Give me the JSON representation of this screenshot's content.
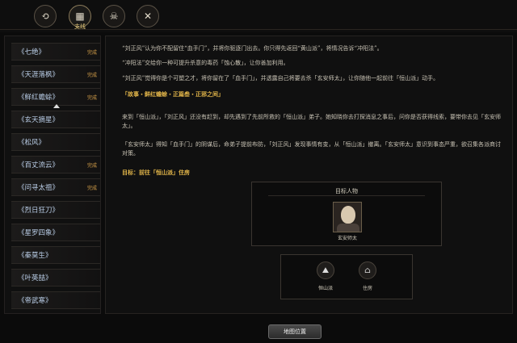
{
  "tabs": {
    "items": [
      {
        "icon": "quest-icon",
        "glyph": "⟲"
      },
      {
        "icon": "scroll-icon",
        "glyph": "▦",
        "label": "支线"
      },
      {
        "icon": "skull-icon",
        "glyph": "☠"
      },
      {
        "icon": "crossed-swords-icon",
        "glyph": "✕"
      }
    ]
  },
  "sidebar": {
    "items": [
      {
        "label": "《七绝》",
        "badge": "完成"
      },
      {
        "label": "《天涯落枫》",
        "badge": "完成"
      },
      {
        "label": "《鲜红蟾蜍》",
        "badge": "完成"
      },
      {
        "label": "《玄天摘星》",
        "badge": ""
      },
      {
        "label": "《松风》",
        "badge": ""
      },
      {
        "label": "《百丈流云》",
        "badge": "完成"
      },
      {
        "label": "《问寻太祖》",
        "badge": "完成"
      },
      {
        "label": "《烈日狂刀》",
        "badge": ""
      },
      {
        "label": "《星罗四象》",
        "badge": ""
      },
      {
        "label": "《秦莫生》",
        "badge": ""
      },
      {
        "label": "《叶英喆》",
        "badge": ""
      },
      {
        "label": "《帝武寒》",
        "badge": ""
      }
    ]
  },
  "quest": {
    "p0": "“刘正风”认为你不配留住“血手门”，并将你驱逐门出去。你只得先返回“黄山派”，将情况告诉“冲阳法”。",
    "p1": "“冲阳法”交给你一种可提升杀意的毒药「蚀心散」，让你善加利用。",
    "p2": "“刘正风”觉得你是个可塑之才，将你留在了「血手门」，并透露自己将要去杀「玄安师太」，让你随他一起前往「恒山派」动手。",
    "chapter": "「故事・鲜红蟾蜍・正篇叁・正邪之间」",
    "p3": "来到「恒山派」，「刘正风」还没有赶到，却先遇到了先前所救的「恒山派」弟子。她知晓你去打探消息之事后，问你是否获得线索，要带你去见「玄安师太」。",
    "p4": "「玄安师太」得知「血手门」的阴谋后，命弟子提前布防，「刘正风」发现事情有变，从「恒山派」撤离。「玄安师太」意识到事态严重，欲召集各派商讨对策。",
    "goal_label": "目标：",
    "goal_text": "前往「恒山派」住房"
  },
  "people": {
    "title": "目标人物",
    "name": "玄安师太"
  },
  "locations": [
    {
      "icon": "mountain-sect-icon",
      "glyph": "⛰",
      "label": "恒山派"
    },
    {
      "icon": "house-icon",
      "glyph": "⌂",
      "label": "住房"
    }
  ],
  "buttons": {
    "map": "地图位置"
  }
}
